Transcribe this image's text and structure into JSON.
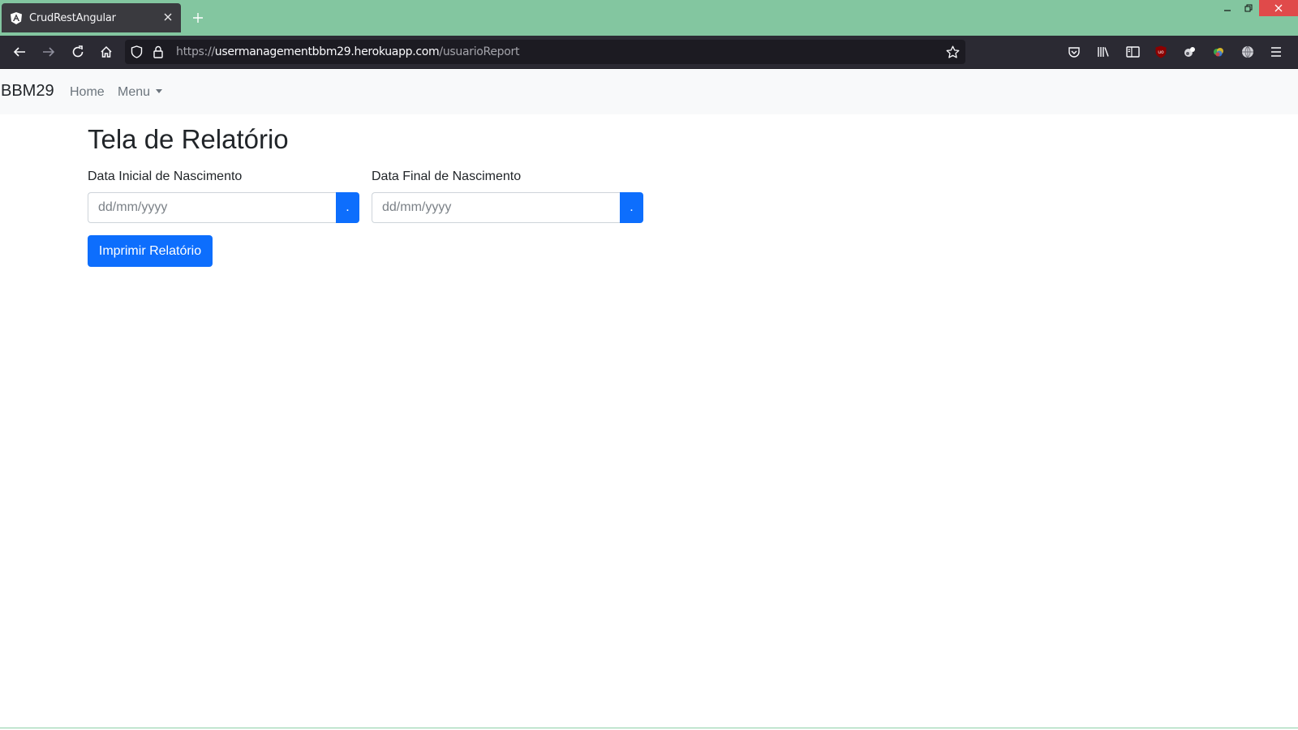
{
  "browser": {
    "tab_title": "CrudRestAngular",
    "url_scheme": "https://",
    "url_host": "usermanagementbbm29.herokuapp.com",
    "url_path": "/usuarioReport",
    "colors": {
      "titlebar": "#83c6a0",
      "toolbar": "#2b2a33",
      "close": "#e04a4a"
    }
  },
  "navbar": {
    "brand": "BBM29",
    "links": [
      "Home",
      "Menu"
    ]
  },
  "page": {
    "title": "Tela de Relatório",
    "start_label": "Data Inicial de Nascimento",
    "end_label": "Data Final de Nascimento",
    "date_placeholder": "dd/mm/yyyy",
    "picker_label": ".",
    "submit_label": "Imprimir Relatório",
    "accent_color": "#0d6efd"
  }
}
